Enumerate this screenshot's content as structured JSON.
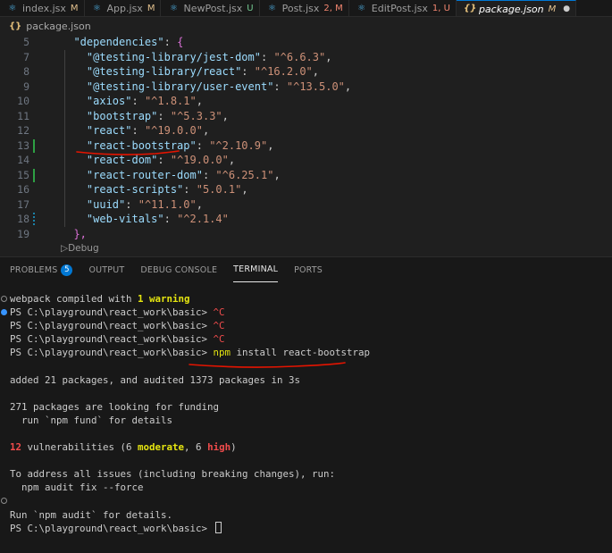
{
  "tabs": [
    {
      "icon": "react-icon",
      "glyph": "⚛",
      "label": "index.jsx",
      "status": "M",
      "status_color": "#e2c08d"
    },
    {
      "icon": "react-icon",
      "glyph": "⚛",
      "label": "App.jsx",
      "status": "M",
      "status_color": "#e2c08d"
    },
    {
      "icon": "react-icon",
      "glyph": "⚛",
      "label": "NewPost.jsx",
      "status": "U",
      "status_color": "#73c991"
    },
    {
      "icon": "react-icon",
      "glyph": "⚛",
      "label": "Post.jsx",
      "status": "2, M",
      "status_color": "#f48771"
    },
    {
      "icon": "react-icon",
      "glyph": "⚛",
      "label": "EditPost.jsx",
      "status": "1, U",
      "status_color": "#f48771"
    },
    {
      "icon": "json-icon",
      "glyph": "{}",
      "label": "package.json",
      "status": "M",
      "status_color": "#e2c08d"
    }
  ],
  "breadcrumb": {
    "file": "package.json"
  },
  "editor": {
    "lines": [
      {
        "n": "5",
        "key": "\"dependencies\"",
        "after": ": ",
        "value": "",
        "end": "{"
      },
      {
        "n": "7",
        "key": "\"@testing-library/jest-dom\"",
        "after": ": ",
        "value": "\"^6.6.3\"",
        "end": ","
      },
      {
        "n": "8",
        "key": "\"@testing-library/react\"",
        "after": ": ",
        "value": "\"^16.2.0\"",
        "end": ","
      },
      {
        "n": "9",
        "key": "\"@testing-library/user-event\"",
        "after": ": ",
        "value": "\"^13.5.0\"",
        "end": ","
      },
      {
        "n": "10",
        "key": "\"axios\"",
        "after": ": ",
        "value": "\"^1.8.1\"",
        "end": ","
      },
      {
        "n": "11",
        "key": "\"bootstrap\"",
        "after": ": ",
        "value": "\"^5.3.3\"",
        "end": ","
      },
      {
        "n": "12",
        "key": "\"react\"",
        "after": ": ",
        "value": "\"^19.0.0\"",
        "end": ","
      },
      {
        "n": "13",
        "key": "\"react-bootstrap\"",
        "after": ": ",
        "value": "\"^2.10.9\"",
        "end": ","
      },
      {
        "n": "14",
        "key": "\"react-dom\"",
        "after": ": ",
        "value": "\"^19.0.0\"",
        "end": ","
      },
      {
        "n": "15",
        "key": "\"react-router-dom\"",
        "after": ": ",
        "value": "\"^6.25.1\"",
        "end": ","
      },
      {
        "n": "16",
        "key": "\"react-scripts\"",
        "after": ": ",
        "value": "\"5.0.1\"",
        "end": ","
      },
      {
        "n": "17",
        "key": "\"uuid\"",
        "after": ": ",
        "value": "\"^11.1.0\"",
        "end": ","
      },
      {
        "n": "18",
        "key": "\"web-vitals\"",
        "after": ": ",
        "value": "\"^2.1.4\"",
        "end": ""
      },
      {
        "n": "19",
        "key": "",
        "after": "",
        "value": "",
        "end": "},"
      }
    ],
    "codelens": "▷Debug"
  },
  "panel": {
    "tabs": [
      "PROBLEMS",
      "OUTPUT",
      "DEBUG CONSOLE",
      "TERMINAL",
      "PORTS"
    ],
    "problems_count": "5",
    "active_tab": "TERMINAL"
  },
  "terminal": {
    "webpack_prefix": "webpack compiled with ",
    "webpack_warning": "1 warning",
    "prompt": "PS C:\\playground\\react_work\\basic> ",
    "ctrl_c": "^C",
    "command_npm": "npm",
    "command_rest": " install react-bootstrap",
    "added": "added 21 packages, and audited 1373 packages in 3s",
    "funding1": "271 packages are looking for funding",
    "funding2": "  run `npm fund` for details",
    "vuln_count": "12",
    "vuln_mid": " vulnerabilities (6 ",
    "vuln_moderate": "moderate",
    "vuln_comma": ", 6 ",
    "vuln_high": "high",
    "vuln_end": ")",
    "address1": "To address all issues (including breaking changes), run:",
    "address2": "  npm audit fix --force",
    "audit": "Run `npm audit` for details."
  },
  "colors": {
    "accent": "#0078d4",
    "annotation": "#e51400"
  }
}
